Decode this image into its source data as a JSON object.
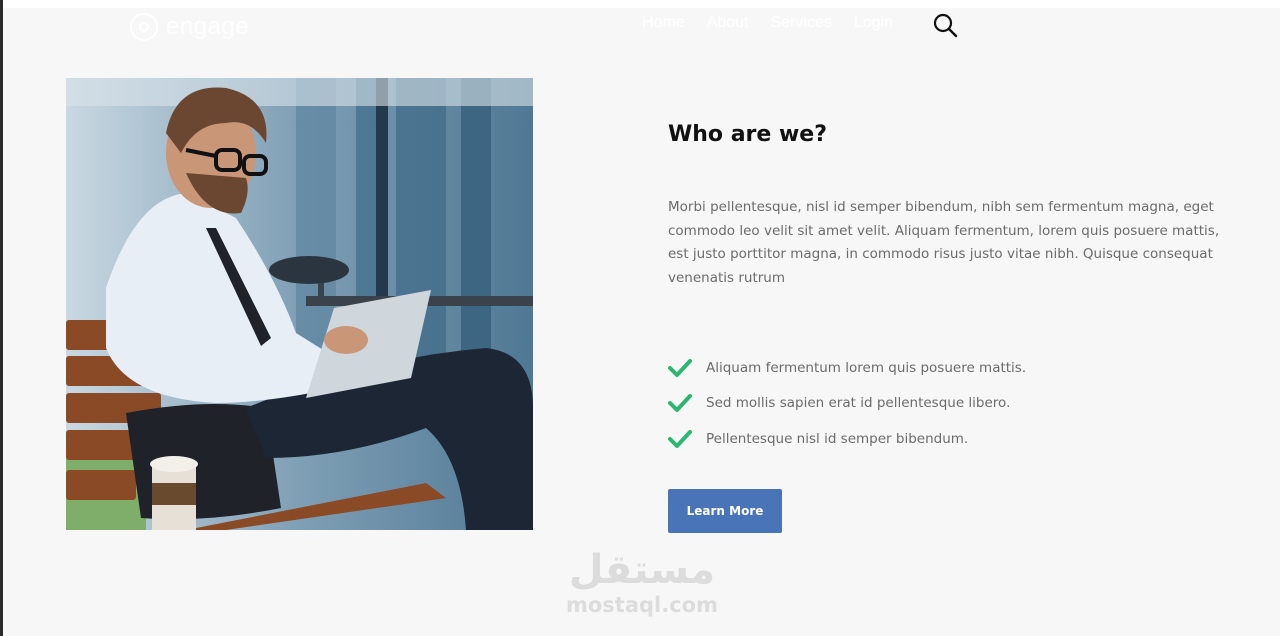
{
  "brand": {
    "name": "engage"
  },
  "nav": {
    "items": [
      {
        "label": "Home"
      },
      {
        "label": "About"
      },
      {
        "label": "Services"
      },
      {
        "label": "Login"
      }
    ]
  },
  "about": {
    "heading": "Who are we?",
    "body": "Morbi pellentesque, nisl id semper bibendum, nibh sem fermentum magna, eget commodo leo velit sit amet velit. Aliquam fermentum, lorem quis posuere mattis, est justo porttitor magna, in commodo risus justo vitae nibh. Quisque consequat venenatis rutrum",
    "checklist": [
      "Aliquam fermentum lorem quis posuere mattis.",
      "Sed mollis sapien erat id pellentesque libero.",
      "Pellentesque nisl id semper bibendum."
    ],
    "cta_label": "Learn More"
  },
  "watermark": {
    "arabic": "مستقل",
    "latin": "mostaql.com"
  },
  "colors": {
    "accent": "#4a74b8",
    "check": "#2bb673",
    "background": "#f7f7f7"
  },
  "icons": {
    "search": "search-icon",
    "check": "check-icon"
  }
}
